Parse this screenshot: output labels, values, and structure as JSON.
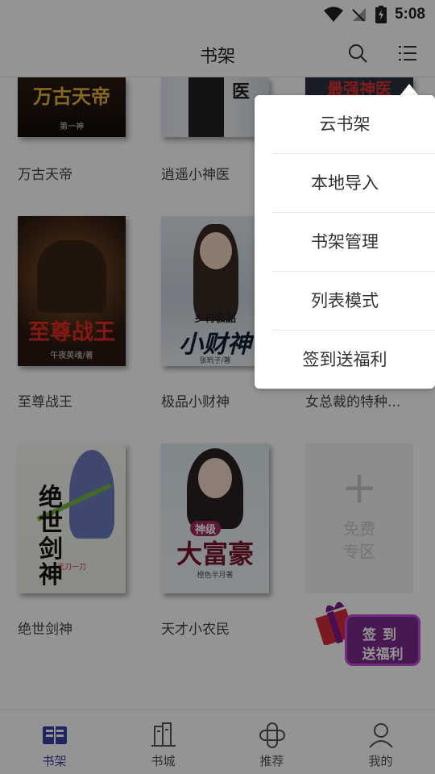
{
  "status": {
    "time": "5:08"
  },
  "header": {
    "title": "书架"
  },
  "books": [
    {
      "title": "万古天帝",
      "cover_text": "万古天帝",
      "author": "第一神"
    },
    {
      "title": "逍遥小神医",
      "cover_text": "医"
    },
    {
      "title": "最强神医",
      "cover_text": "最强神医"
    },
    {
      "title": "至尊战王",
      "cover_text": "至尊战王",
      "author": "午夜英魂/著"
    },
    {
      "title": "极品小财神",
      "cover_text_top": "乡村极品",
      "cover_text": "小财神",
      "author": "张玳子/著"
    },
    {
      "title": "女总裁的特种..."
    },
    {
      "title": "绝世剑神",
      "cover_text": "绝世剑神",
      "author": "无刀一刀"
    },
    {
      "title": "天才小农民",
      "cover_text_top": "神级",
      "cover_text": "大富豪",
      "author": "橙色半月著"
    }
  ],
  "free_zone": {
    "line1": "免费",
    "line2": "专区"
  },
  "menu": {
    "items": [
      "云书架",
      "本地导入",
      "书架管理",
      "列表模式",
      "签到送福利"
    ]
  },
  "signin": {
    "line1": "签到",
    "line2": "送福利"
  },
  "nav": {
    "tabs": [
      {
        "label": "书架",
        "icon": "bookshelf-icon",
        "active": true
      },
      {
        "label": "书城",
        "icon": "bookstore-icon",
        "active": false
      },
      {
        "label": "推荐",
        "icon": "recommend-icon",
        "active": false
      },
      {
        "label": "我的",
        "icon": "profile-icon",
        "active": false
      }
    ]
  },
  "colors": {
    "accent": "#3b3fa7",
    "overlay": "rgba(0,0,0,0.42)",
    "signin": "#7a2a8c"
  }
}
